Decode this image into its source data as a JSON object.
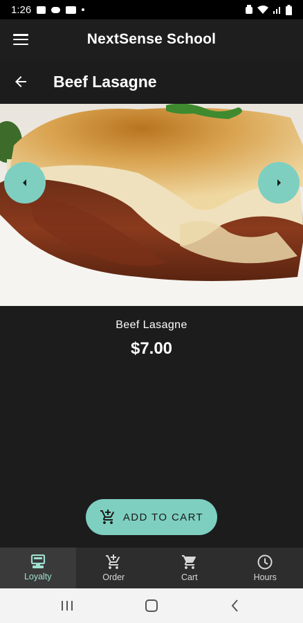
{
  "status": {
    "time": "1:26"
  },
  "app_bar": {
    "title": "NextSense School"
  },
  "page": {
    "title": "Beef Lasagne"
  },
  "product": {
    "name": "Beef Lasagne",
    "price": "$7.00"
  },
  "actions": {
    "add_to_cart": "ADD TO CART"
  },
  "bottom_nav": {
    "items": [
      {
        "label": "Loyalty",
        "icon": "loyalty-register-icon",
        "active": true
      },
      {
        "label": "Order",
        "icon": "add-cart-icon",
        "active": false
      },
      {
        "label": "Cart",
        "icon": "cart-icon",
        "active": false
      },
      {
        "label": "Hours",
        "icon": "clock-icon",
        "active": false
      }
    ]
  },
  "colors": {
    "accent": "#7ecfc0",
    "accent_text": "#9fe0cf",
    "background": "#1c1c1c",
    "nav_background": "#2d2d2d"
  }
}
